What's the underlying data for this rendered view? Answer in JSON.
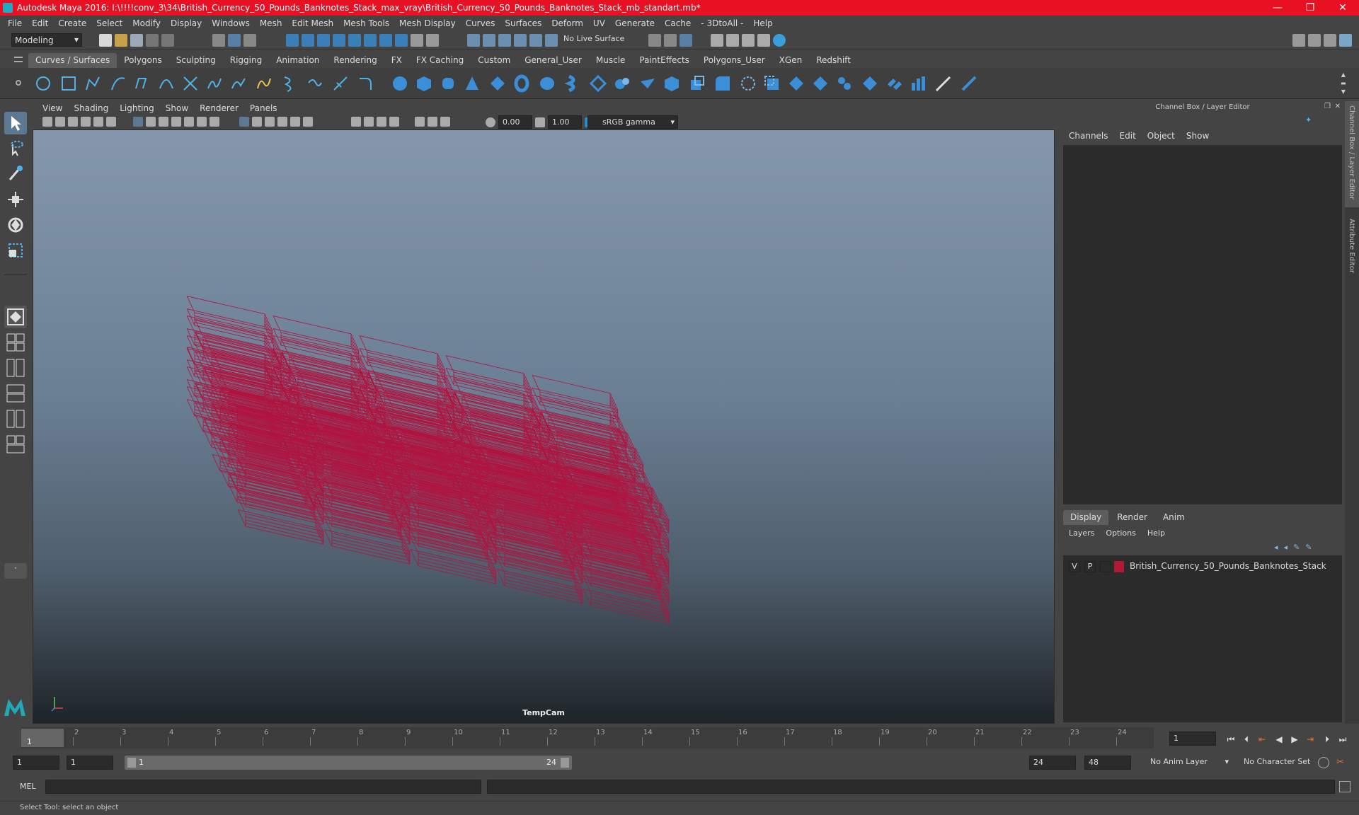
{
  "title": "Autodesk Maya 2016: I:\\!!!!conv_3\\34\\British_Currency_50_Pounds_Banknotes_Stack_max_vray\\British_Currency_50_Pounds_Banknotes_Stack_mb_standart.mb*",
  "window_controls": {
    "minimize": "—",
    "maximize": "❐",
    "close": "✕"
  },
  "menus": [
    "File",
    "Edit",
    "Create",
    "Select",
    "Modify",
    "Display",
    "Windows",
    "Mesh",
    "Edit Mesh",
    "Mesh Tools",
    "Mesh Display",
    "Curves",
    "Surfaces",
    "Deform",
    "UV",
    "Generate",
    "Cache",
    "- 3DtoAll -",
    "Help"
  ],
  "status": {
    "mode": "Modeling",
    "live_surface": "No Live Surface"
  },
  "shelf_tabs": [
    "Curves / Surfaces",
    "Polygons",
    "Sculpting",
    "Rigging",
    "Animation",
    "Rendering",
    "FX",
    "FX Caching",
    "Custom",
    "General_User",
    "Muscle",
    "PaintEffects",
    "Polygons_User",
    "XGen",
    "Redshift"
  ],
  "viewport": {
    "menus": [
      "View",
      "Shading",
      "Lighting",
      "Show",
      "Renderer",
      "Panels"
    ],
    "exposure": "0.00",
    "gamma": "1.00",
    "color_space": "sRGB gamma",
    "camera": "TempCam",
    "wire_color": "#b0133f"
  },
  "channel_box": {
    "title": "Channel Box / Layer Editor",
    "menus": [
      "Channels",
      "Edit",
      "Object",
      "Show"
    ]
  },
  "layer_editor": {
    "tabs": [
      "Display",
      "Render",
      "Anim"
    ],
    "menus": [
      "Layers",
      "Options",
      "Help"
    ],
    "layer": {
      "v": "V",
      "p": "P",
      "name": "British_Currency_50_Pounds_Banknotes_Stack",
      "color": "#b01a35"
    }
  },
  "side_tabs": [
    "Channel Box / Layer Editor",
    "Attribute Editor"
  ],
  "timeline": {
    "ticks": [
      "1",
      "2",
      "3",
      "4",
      "5",
      "6",
      "7",
      "8",
      "9",
      "10",
      "11",
      "12",
      "13",
      "14",
      "15",
      "16",
      "17",
      "18",
      "19",
      "20",
      "21",
      "22",
      "23",
      "24"
    ],
    "current_marker": "1",
    "current_frame": "1"
  },
  "range": {
    "start": "1",
    "playback_start": "1",
    "slider_start": "1",
    "slider_end": "24",
    "playback_end": "24",
    "end": "48",
    "anim_layer": "No Anim Layer",
    "character_set": "No Character Set"
  },
  "command": {
    "label": "MEL"
  },
  "help_line": "Select Tool: select an object"
}
